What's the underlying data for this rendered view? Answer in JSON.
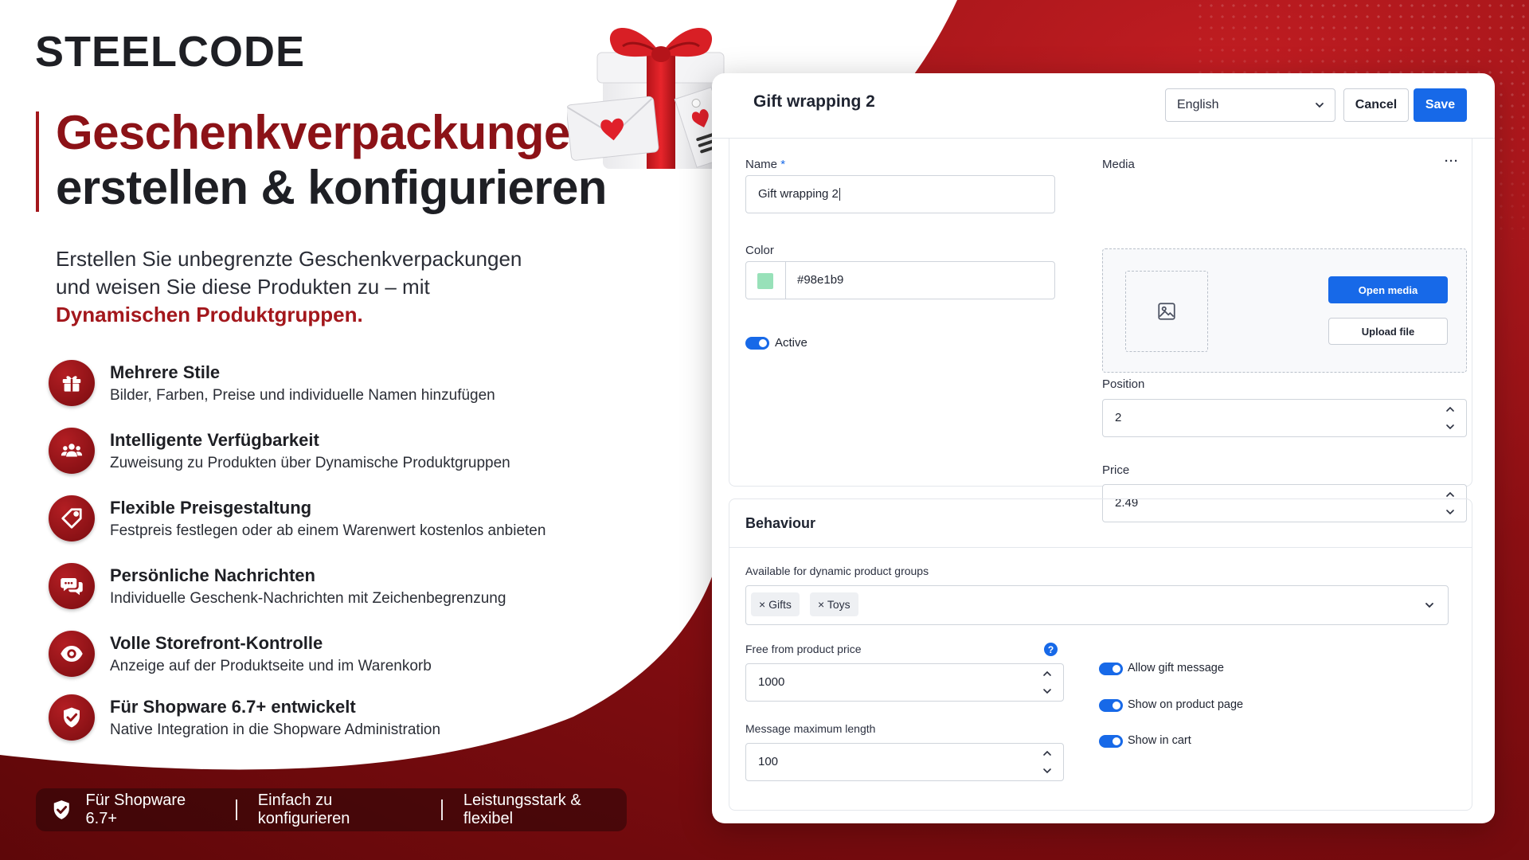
{
  "brand": "STEELCODE",
  "headline": {
    "line1": "Geschenkverpackungen",
    "line2": "erstellen & konfigurieren"
  },
  "intro": {
    "line1": "Erstellen Sie unbegrenzte Geschenkverpackungen",
    "line2": "und weisen Sie diese Produkten zu – mit",
    "highlight": "Dynamischen Produktgruppen."
  },
  "features": [
    {
      "icon": "gift-icon",
      "title": "Mehrere Stile",
      "desc": "Bilder, Farben, Preise und individuelle Namen hinzufügen"
    },
    {
      "icon": "users-icon",
      "title": "Intelligente Verfügbarkeit",
      "desc": "Zuweisung zu Produkten über Dynamische Produktgruppen"
    },
    {
      "icon": "price-tag-icon",
      "title": "Flexible Preisgestaltung",
      "desc": "Festpreis festlegen oder ab einem Warenwert kostenlos anbieten"
    },
    {
      "icon": "chat-icon",
      "title": "Persönliche Nachrichten",
      "desc": "Individuelle Geschenk-Nachrichten mit Zeichenbegrenzung"
    },
    {
      "icon": "eye-icon",
      "title": "Volle Storefront-Kontrolle",
      "desc": "Anzeige auf der Produktseite und im Warenkorb"
    },
    {
      "icon": "shield-check-icon",
      "title": "Für Shopware 6.7+ entwickelt",
      "desc": "Native Integration in die Shopware Administration"
    }
  ],
  "bottom_strip": [
    "Für Shopware 6.7+",
    "Einfach zu konfigurieren",
    "Leistungsstark & flexibel"
  ],
  "panel": {
    "title": "Gift wrapping 2",
    "language": "English",
    "cancel_label": "Cancel",
    "save_label": "Save",
    "name_label": "Name",
    "required_mark": "*",
    "name_value": "Gift wrapping 2",
    "color_label": "Color",
    "color_value": "#98e1b9",
    "active_label": "Active",
    "media_label": "Media",
    "more_label": "···",
    "open_media_label": "Open media",
    "upload_file_label": "Upload file",
    "position_label": "Position",
    "position_value": "2",
    "price_label": "Price",
    "price_value": "2.49"
  },
  "behaviour": {
    "title": "Behaviour",
    "groups_label": "Available for dynamic product groups",
    "tags": [
      "Gifts",
      "Toys"
    ],
    "tag_remove": "×",
    "free_label": "Free from product price",
    "help_mark": "?",
    "free_value": "1000",
    "max_len_label": "Message maximum length",
    "max_len_value": "100",
    "toggles": [
      "Allow gift message",
      "Show on product page",
      "Show in cart"
    ]
  },
  "colors": {
    "accent_red": "#a3171c",
    "primary_blue": "#1769e8",
    "swatch": "#98e1b9"
  }
}
